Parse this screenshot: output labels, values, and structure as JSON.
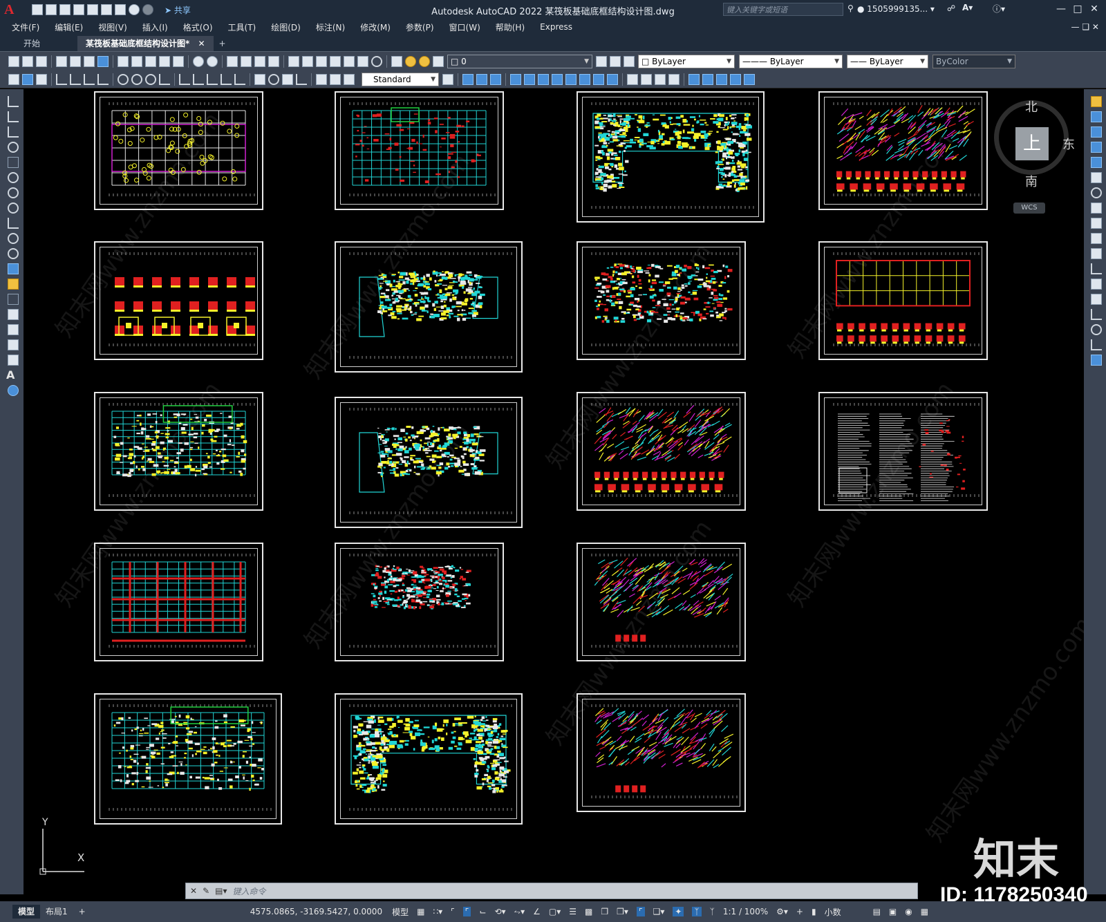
{
  "app": {
    "title": "Autodesk AutoCAD 2022    某筏板基础底框结构设计图.dwg",
    "share_label": "共享",
    "search_placeholder": "键入关键字或短语",
    "user": "1505999135...",
    "logo": "A"
  },
  "menu": {
    "items": [
      "文件(F)",
      "编辑(E)",
      "视图(V)",
      "插入(I)",
      "格式(O)",
      "工具(T)",
      "绘图(D)",
      "标注(N)",
      "修改(M)",
      "参数(P)",
      "窗口(W)",
      "帮助(H)",
      "Express"
    ]
  },
  "tabs": {
    "start": "开始",
    "file": "某筏板基础底框结构设计图*"
  },
  "toolbar": {
    "layer_value": "0",
    "color_value": "ByLayer",
    "linetype_value": "ByLayer",
    "lineweight_value": "ByLayer",
    "plotstyle_value": "ByColor",
    "textstyle_value": "Standard"
  },
  "viewcube": {
    "north": "北",
    "south": "南",
    "east": "东",
    "top": "上",
    "wcs": "WCS"
  },
  "ucs": {
    "x": "X",
    "y": "Y"
  },
  "command": {
    "placeholder": "键入命令"
  },
  "layouts": [
    "模型",
    "布局1"
  ],
  "status": {
    "coords": "4575.0865, -3169.5427, 0.0000",
    "model": "模型",
    "scale": "1:1 / 100%",
    "units": "小数"
  },
  "watermark": {
    "brand": "知末",
    "id": "ID: 1178250340",
    "site": "znzmo.com"
  },
  "colors": {
    "cyan": "#21d6d6",
    "yellow": "#f5f22a",
    "red": "#e02020",
    "magenta": "#d020d0",
    "green": "#20d040",
    "white": "#e8e8e8"
  }
}
